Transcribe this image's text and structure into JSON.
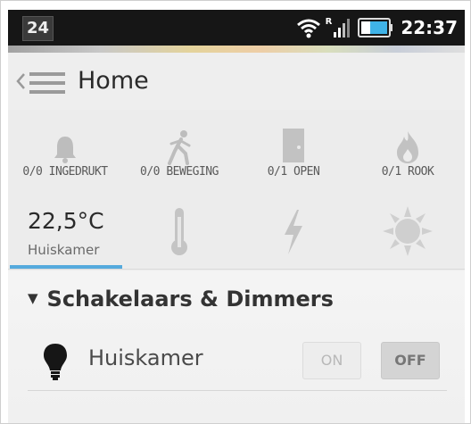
{
  "status_bar": {
    "badge": "24",
    "time": "22:37",
    "network_label": "R",
    "icons": [
      "wifi-icon",
      "signal-icon",
      "battery-icon"
    ]
  },
  "action_bar": {
    "title": "Home",
    "icons": [
      "back-icon",
      "menu-icon"
    ]
  },
  "sensors": [
    {
      "icon": "bell-icon",
      "label": "0/0 INGEDRUKT"
    },
    {
      "icon": "walking-person-icon",
      "label": "0/0 BEWEGING"
    },
    {
      "icon": "door-icon",
      "label": "0/1 OPEN"
    },
    {
      "icon": "flame-icon",
      "label": "0/1 ROOK"
    }
  ],
  "climate": {
    "temperature": "22,5°C",
    "room": "Huiskamer",
    "icons": [
      "thermometer-icon",
      "lightning-icon",
      "sun-icon"
    ]
  },
  "section": {
    "title": "Schakelaars & Dimmers"
  },
  "devices": [
    {
      "icon": "bulb-icon",
      "name": "Huiskamer",
      "on_label": "ON",
      "off_label": "OFF",
      "state": "off"
    }
  ],
  "colors": {
    "accent": "#55aadd",
    "status_bar": "#161616",
    "background": "#f4f4f4"
  }
}
